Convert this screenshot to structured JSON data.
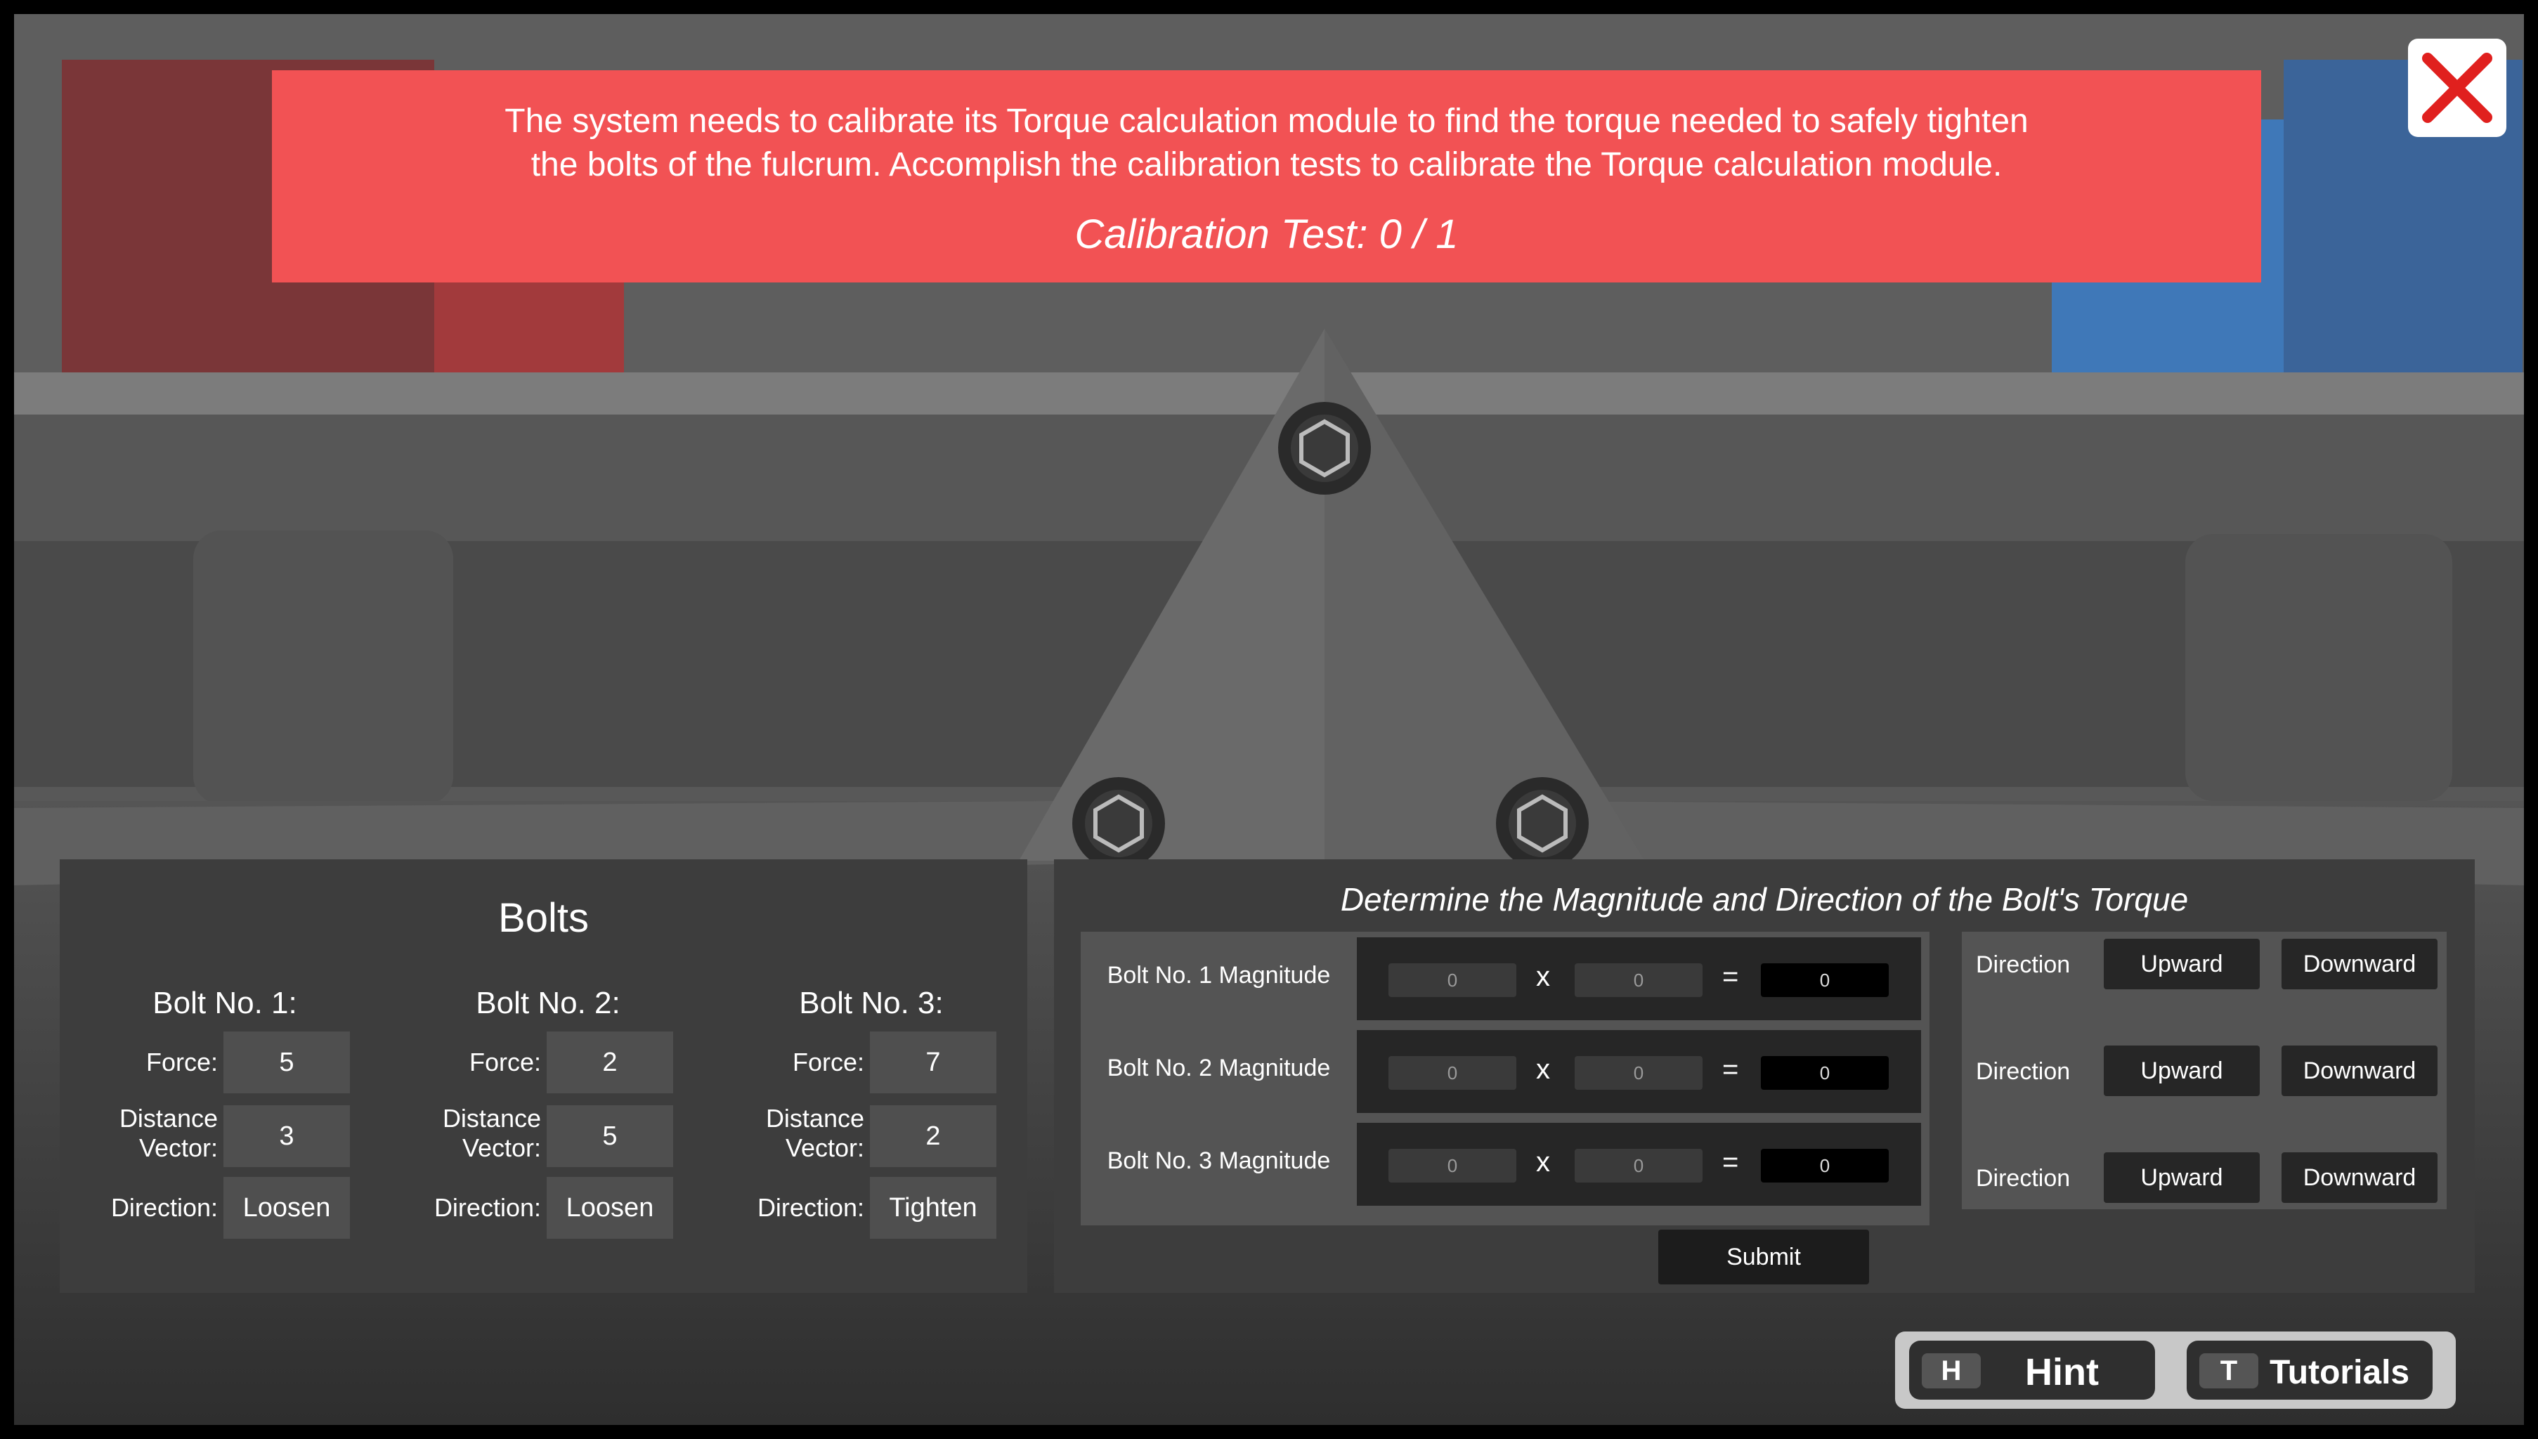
{
  "banner": {
    "message_line1": "The system needs to calibrate its Torque calculation module to find the torque needed to safely tighten",
    "message_line2": "the bolts of the fulcrum. Accomplish the calibration tests to calibrate the Torque calculation module.",
    "calibration": "Calibration Test: 0 / 1"
  },
  "close_icon": "close-x-icon",
  "colors": {
    "banner": "#f25254",
    "close_x": "#e0201e",
    "panel": "#3d3d3d"
  },
  "bolts": {
    "title": "Bolts",
    "labels": {
      "force": "Force:",
      "distance_line1": "Distance",
      "distance_line2": "Vector:",
      "direction": "Direction:"
    },
    "items": [
      {
        "name": "Bolt No. 1:",
        "force": "5",
        "distance": "3",
        "direction": "Loosen"
      },
      {
        "name": "Bolt No. 2:",
        "force": "2",
        "distance": "5",
        "direction": "Loosen"
      },
      {
        "name": "Bolt No. 3:",
        "force": "7",
        "distance": "2",
        "direction": "Tighten"
      }
    ]
  },
  "torque": {
    "title": "Determine the Magnitude and Direction of the Bolt's Torque",
    "op_multiply": "x",
    "op_equals": "=",
    "rows": [
      {
        "label": "Bolt No. 1 Magnitude",
        "a": "0",
        "b": "0",
        "result": "0"
      },
      {
        "label": "Bolt No. 2 Magnitude",
        "a": "0",
        "b": "0",
        "result": "0"
      },
      {
        "label": "Bolt No. 3 Magnitude",
        "a": "0",
        "b": "0",
        "result": "0"
      }
    ],
    "direction_label": "Direction",
    "upward": "Upward",
    "downward": "Downward",
    "submit": "Submit"
  },
  "hint_bar": {
    "hint_key": "H",
    "hint_label": "Hint",
    "tutorials_key": "T",
    "tutorials_label": "Tutorials"
  }
}
